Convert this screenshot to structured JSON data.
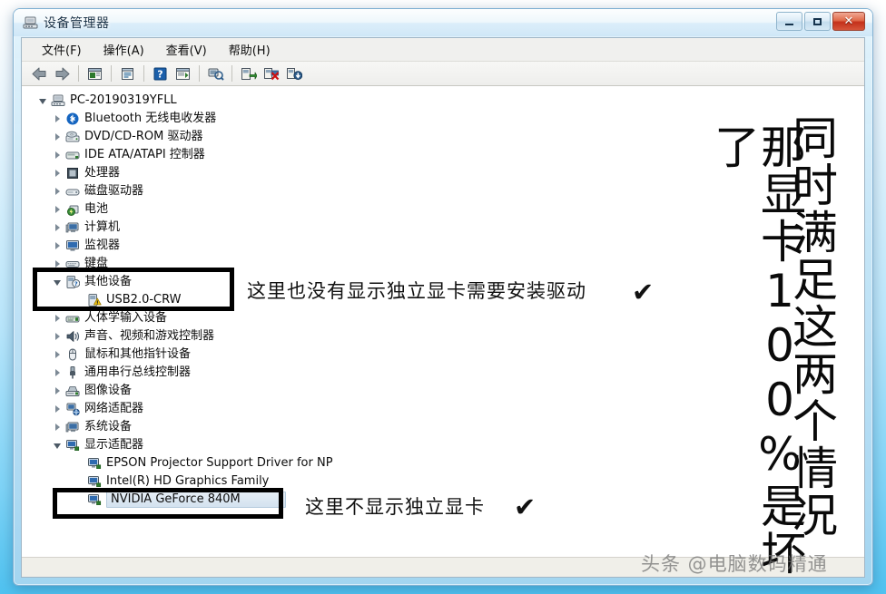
{
  "window": {
    "title": "设备管理器",
    "title_icon": "device-manager-icon",
    "controls": {
      "minimize": "minimize-icon",
      "maximize": "maximize-icon",
      "close": "✕"
    }
  },
  "menubar": {
    "items": [
      {
        "label": "文件(F)",
        "name": "menu-file"
      },
      {
        "label": "操作(A)",
        "name": "menu-action"
      },
      {
        "label": "查看(V)",
        "name": "menu-view"
      },
      {
        "label": "帮助(H)",
        "name": "menu-help"
      }
    ]
  },
  "toolbar": {
    "buttons": [
      {
        "name": "back-icon",
        "glyph": "back"
      },
      {
        "name": "forward-icon",
        "glyph": "forward"
      },
      {
        "name": "sep",
        "glyph": "sep"
      },
      {
        "name": "show-hidden-icon",
        "glyph": "panel"
      },
      {
        "name": "sep",
        "glyph": "sep"
      },
      {
        "name": "properties-icon",
        "glyph": "props"
      },
      {
        "name": "sep",
        "glyph": "sep"
      },
      {
        "name": "help-icon",
        "glyph": "help"
      },
      {
        "name": "console-icon",
        "glyph": "console"
      },
      {
        "name": "sep",
        "glyph": "sep"
      },
      {
        "name": "scan-hardware-icon",
        "glyph": "scan"
      },
      {
        "name": "sep",
        "glyph": "sep"
      },
      {
        "name": "update-driver-icon",
        "glyph": "update"
      },
      {
        "name": "disable-device-icon",
        "glyph": "disable"
      },
      {
        "name": "uninstall-device-icon",
        "glyph": "uninstall"
      }
    ]
  },
  "tree": {
    "root": {
      "label": "PC-20190319YFLL",
      "icon": "computer-icon",
      "state": "open",
      "indent": 0
    },
    "nodes": [
      {
        "label": "Bluetooth 无线电收发器",
        "icon": "bluetooth-icon",
        "state": "closed",
        "indent": 1,
        "name": "tree-node-bluetooth"
      },
      {
        "label": "DVD/CD-ROM 驱动器",
        "icon": "dvd-icon",
        "state": "closed",
        "indent": 1,
        "name": "tree-node-dvd"
      },
      {
        "label": "IDE ATA/ATAPI 控制器",
        "icon": "ide-icon",
        "state": "closed",
        "indent": 1,
        "name": "tree-node-ide"
      },
      {
        "label": "处理器",
        "icon": "cpu-icon",
        "state": "closed",
        "indent": 1,
        "name": "tree-node-processor"
      },
      {
        "label": "磁盘驱动器",
        "icon": "disk-icon",
        "state": "closed",
        "indent": 1,
        "name": "tree-node-disk"
      },
      {
        "label": "电池",
        "icon": "battery-icon",
        "state": "closed",
        "indent": 1,
        "name": "tree-node-battery"
      },
      {
        "label": "计算机",
        "icon": "computer2-icon",
        "state": "closed",
        "indent": 1,
        "name": "tree-node-computer"
      },
      {
        "label": "监视器",
        "icon": "monitor-icon",
        "state": "closed",
        "indent": 1,
        "name": "tree-node-monitor"
      },
      {
        "label": "键盘",
        "icon": "keyboard-icon",
        "state": "closed",
        "indent": 1,
        "name": "tree-node-keyboard"
      },
      {
        "label": "其他设备",
        "icon": "unknown-device-icon",
        "state": "open",
        "indent": 1,
        "name": "tree-node-other-devices"
      },
      {
        "label": "USB2.0-CRW",
        "icon": "warning-device-icon",
        "state": "none",
        "indent": 2,
        "name": "tree-node-usb20-crw"
      },
      {
        "label": "人体学输入设备",
        "icon": "hid-icon",
        "state": "closed",
        "indent": 1,
        "name": "tree-node-hid"
      },
      {
        "label": "声音、视频和游戏控制器",
        "icon": "sound-icon",
        "state": "closed",
        "indent": 1,
        "name": "tree-node-sound"
      },
      {
        "label": "鼠标和其他指针设备",
        "icon": "mouse-icon",
        "state": "closed",
        "indent": 1,
        "name": "tree-node-mouse"
      },
      {
        "label": "通用串行总线控制器",
        "icon": "usb-icon",
        "state": "closed",
        "indent": 1,
        "name": "tree-node-usb"
      },
      {
        "label": "图像设备",
        "icon": "imaging-icon",
        "state": "closed",
        "indent": 1,
        "name": "tree-node-imaging"
      },
      {
        "label": "网络适配器",
        "icon": "network-icon",
        "state": "closed",
        "indent": 1,
        "name": "tree-node-network"
      },
      {
        "label": "系统设备",
        "icon": "system-icon",
        "state": "closed",
        "indent": 1,
        "name": "tree-node-system"
      },
      {
        "label": "显示适配器",
        "icon": "display-icon",
        "state": "open",
        "indent": 1,
        "name": "tree-node-display-adapters"
      },
      {
        "label": "EPSON Projector Support Driver for NP",
        "icon": "display-icon",
        "state": "none",
        "indent": 2,
        "name": "tree-node-epson"
      },
      {
        "label": "Intel(R) HD Graphics Family",
        "icon": "display-icon",
        "state": "none",
        "indent": 2,
        "name": "tree-node-intel-hd"
      },
      {
        "label": "NVIDIA GeForce 840M",
        "icon": "display-icon",
        "state": "none",
        "indent": 2,
        "name": "tree-node-nvidia-840m",
        "selected": true
      }
    ]
  },
  "annotations": {
    "note_other_devices": "这里也没有显示独立显卡需要安装驱动",
    "note_display_adapters": "这里不显示独立显卡",
    "check_glyph": "✔",
    "vertical_left": "那显卡100%是坏了",
    "vertical_right": "同时满足这两个情况"
  },
  "watermark": "头条 @电脑数码精通",
  "colors": {
    "annotation_box": "#000000",
    "selection_fill": "#e6eef6",
    "close_button": "#c4301a",
    "title_text": "#1b3348"
  }
}
